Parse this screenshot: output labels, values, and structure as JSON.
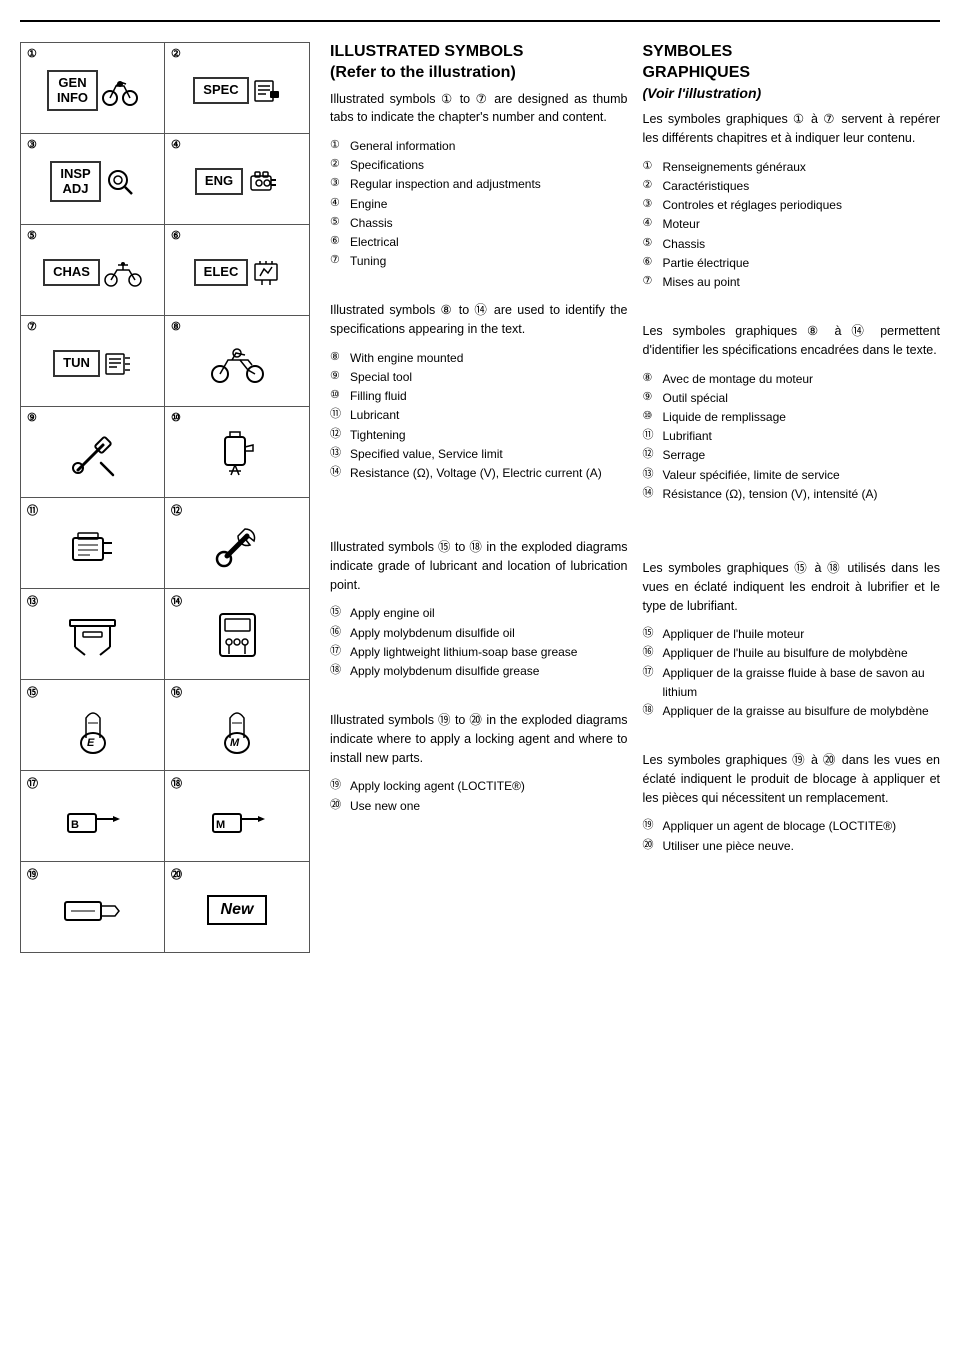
{
  "page": {
    "top_rule": true
  },
  "english": {
    "title1": "ILLUSTRATED SYMBOLS",
    "title2": "(Refer to the illustration)",
    "intro1": "Illustrated symbols ① to ⑦ are designed as thumb tabs to indicate the chapter's number and content.",
    "list1": [
      {
        "num": "①",
        "text": "General information"
      },
      {
        "num": "②",
        "text": "Specifications"
      },
      {
        "num": "③",
        "text": "Regular inspection and adjustments"
      },
      {
        "num": "④",
        "text": "Engine"
      },
      {
        "num": "⑤",
        "text": "Chassis"
      },
      {
        "num": "⑥",
        "text": "Electrical"
      },
      {
        "num": "⑦",
        "text": "Tuning"
      }
    ],
    "intro2": "Illustrated symbols ⑧ to ⑭ are used to identify the specifications appearing in the text.",
    "list2": [
      {
        "num": "⑧",
        "text": "With engine mounted"
      },
      {
        "num": "⑨",
        "text": "Special tool"
      },
      {
        "num": "⑩",
        "text": "Filling fluid"
      },
      {
        "num": "⑪",
        "text": "Lubricant"
      },
      {
        "num": "⑫",
        "text": "Tightening"
      },
      {
        "num": "⑬",
        "text": "Specified value, Service limit"
      },
      {
        "num": "⑭",
        "text": "Resistance (Ω), Voltage (V), Electric current (A)"
      }
    ],
    "intro3": "Illustrated symbols ⑮ to ⑱ in the exploded diagrams indicate grade of lubricant and location of lubrication point.",
    "list3": [
      {
        "num": "⑮",
        "text": "Apply engine oil"
      },
      {
        "num": "⑯",
        "text": "Apply molybdenum disulfide oil"
      },
      {
        "num": "⑰",
        "text": "Apply lightweight lithium-soap base grease"
      },
      {
        "num": "⑱",
        "text": "Apply molybdenum disulfide grease"
      }
    ],
    "intro4": "Illustrated symbols ⑲ to ⑳ in the exploded diagrams indicate where to apply a locking agent and where to install new parts.",
    "list4": [
      {
        "num": "⑲",
        "text": "Apply locking agent (LOCTITE®)"
      },
      {
        "num": "⑳",
        "text": "Use new one"
      }
    ]
  },
  "french": {
    "title1": "SYMBOLES",
    "title2": "GRAPHIQUES",
    "title3": "(Voir l'illustration)",
    "intro1": "Les symboles graphiques ① à ⑦ servent à repérer les différents chapitres et à indiquer leur contenu.",
    "list1": [
      {
        "num": "①",
        "text": "Renseignements généraux"
      },
      {
        "num": "②",
        "text": "Caractéristiques"
      },
      {
        "num": "③",
        "text": "Controles et réglages periodiques"
      },
      {
        "num": "④",
        "text": "Moteur"
      },
      {
        "num": "⑤",
        "text": "Chassis"
      },
      {
        "num": "⑥",
        "text": "Partie électrique"
      },
      {
        "num": "⑦",
        "text": "Mises au point"
      }
    ],
    "intro2": "Les symboles graphiques ⑧ à ⑭ permettent d'identifier les spécifications encadrées dans le texte.",
    "list2": [
      {
        "num": "⑧",
        "text": "Avec de montage du moteur"
      },
      {
        "num": "⑨",
        "text": "Outil spécial"
      },
      {
        "num": "⑩",
        "text": "Liquide de remplissage"
      },
      {
        "num": "⑪",
        "text": "Lubrifiant"
      },
      {
        "num": "⑫",
        "text": "Serrage"
      },
      {
        "num": "⑬",
        "text": "Valeur spécifiée, limite de service"
      },
      {
        "num": "⑭",
        "text": "Résistance (Ω), tension (V), intensité (A)"
      }
    ],
    "intro3": "Les symboles graphiques ⑮ à ⑱ utilisés dans les vues en éclaté indiquent les endroit à lubrifier et le type de lubrifiant.",
    "list3": [
      {
        "num": "⑮",
        "text": "Appliquer de l'huile moteur"
      },
      {
        "num": "⑯",
        "text": "Appliquer de l'huile au bisulfure de molybdène"
      },
      {
        "num": "⑰",
        "text": "Appliquer de la graisse fluide à base de savon au lithium"
      },
      {
        "num": "⑱",
        "text": "Appliquer de la graisse au bisulfure de molybdène"
      }
    ],
    "intro4": "Les symboles graphiques ⑲ à ⑳ dans les vues en éclaté indiquent le produit de blocage à appliquer et les pièces qui nécessitent un remplacement.",
    "list4": [
      {
        "num": "⑲",
        "text": "Appliquer un agent de blocage (LOCTITE®)"
      },
      {
        "num": "⑳",
        "text": "Utiliser une pièce neuve."
      }
    ]
  },
  "grid": {
    "cells": [
      {
        "num": "①",
        "type": "tab",
        "label1": "GEN",
        "label2": "INFO",
        "icon": "moto"
      },
      {
        "num": "②",
        "type": "tab",
        "label1": "SPEC",
        "label2": "",
        "icon": "wrench-small"
      },
      {
        "num": "③",
        "type": "tab",
        "label1": "INSP",
        "label2": "ADJ",
        "icon": "magnify"
      },
      {
        "num": "④",
        "type": "tab",
        "label1": "ENG",
        "label2": "",
        "icon": "engine"
      },
      {
        "num": "⑤",
        "type": "tab",
        "label1": "CHAS",
        "label2": "",
        "icon": "bicycle"
      },
      {
        "num": "⑥",
        "type": "tab",
        "label1": "ELEC",
        "label2": "",
        "icon": "elec"
      },
      {
        "num": "⑦",
        "type": "tab",
        "label1": "TUN",
        "label2": "",
        "icon": "list"
      },
      {
        "num": "⑧",
        "type": "svg",
        "icon": "moto2"
      },
      {
        "num": "⑨",
        "type": "svg",
        "icon": "tools"
      },
      {
        "num": "⑩",
        "type": "svg",
        "icon": "pour"
      },
      {
        "num": "⑪",
        "type": "svg",
        "icon": "lubricant"
      },
      {
        "num": "⑫",
        "type": "svg",
        "icon": "wrench"
      },
      {
        "num": "⑬",
        "type": "svg",
        "icon": "calipers"
      },
      {
        "num": "⑭",
        "type": "svg",
        "icon": "multimeter"
      },
      {
        "num": "⑮",
        "type": "svg",
        "icon": "oil-e"
      },
      {
        "num": "⑯",
        "type": "svg",
        "icon": "oil-m"
      },
      {
        "num": "⑰",
        "type": "svg",
        "icon": "grease-b"
      },
      {
        "num": "⑱",
        "type": "svg",
        "icon": "grease-m"
      },
      {
        "num": "⑲",
        "type": "svg",
        "icon": "loctite"
      },
      {
        "num": "⑳",
        "type": "new",
        "label": "New"
      }
    ],
    "new_label": "New"
  }
}
